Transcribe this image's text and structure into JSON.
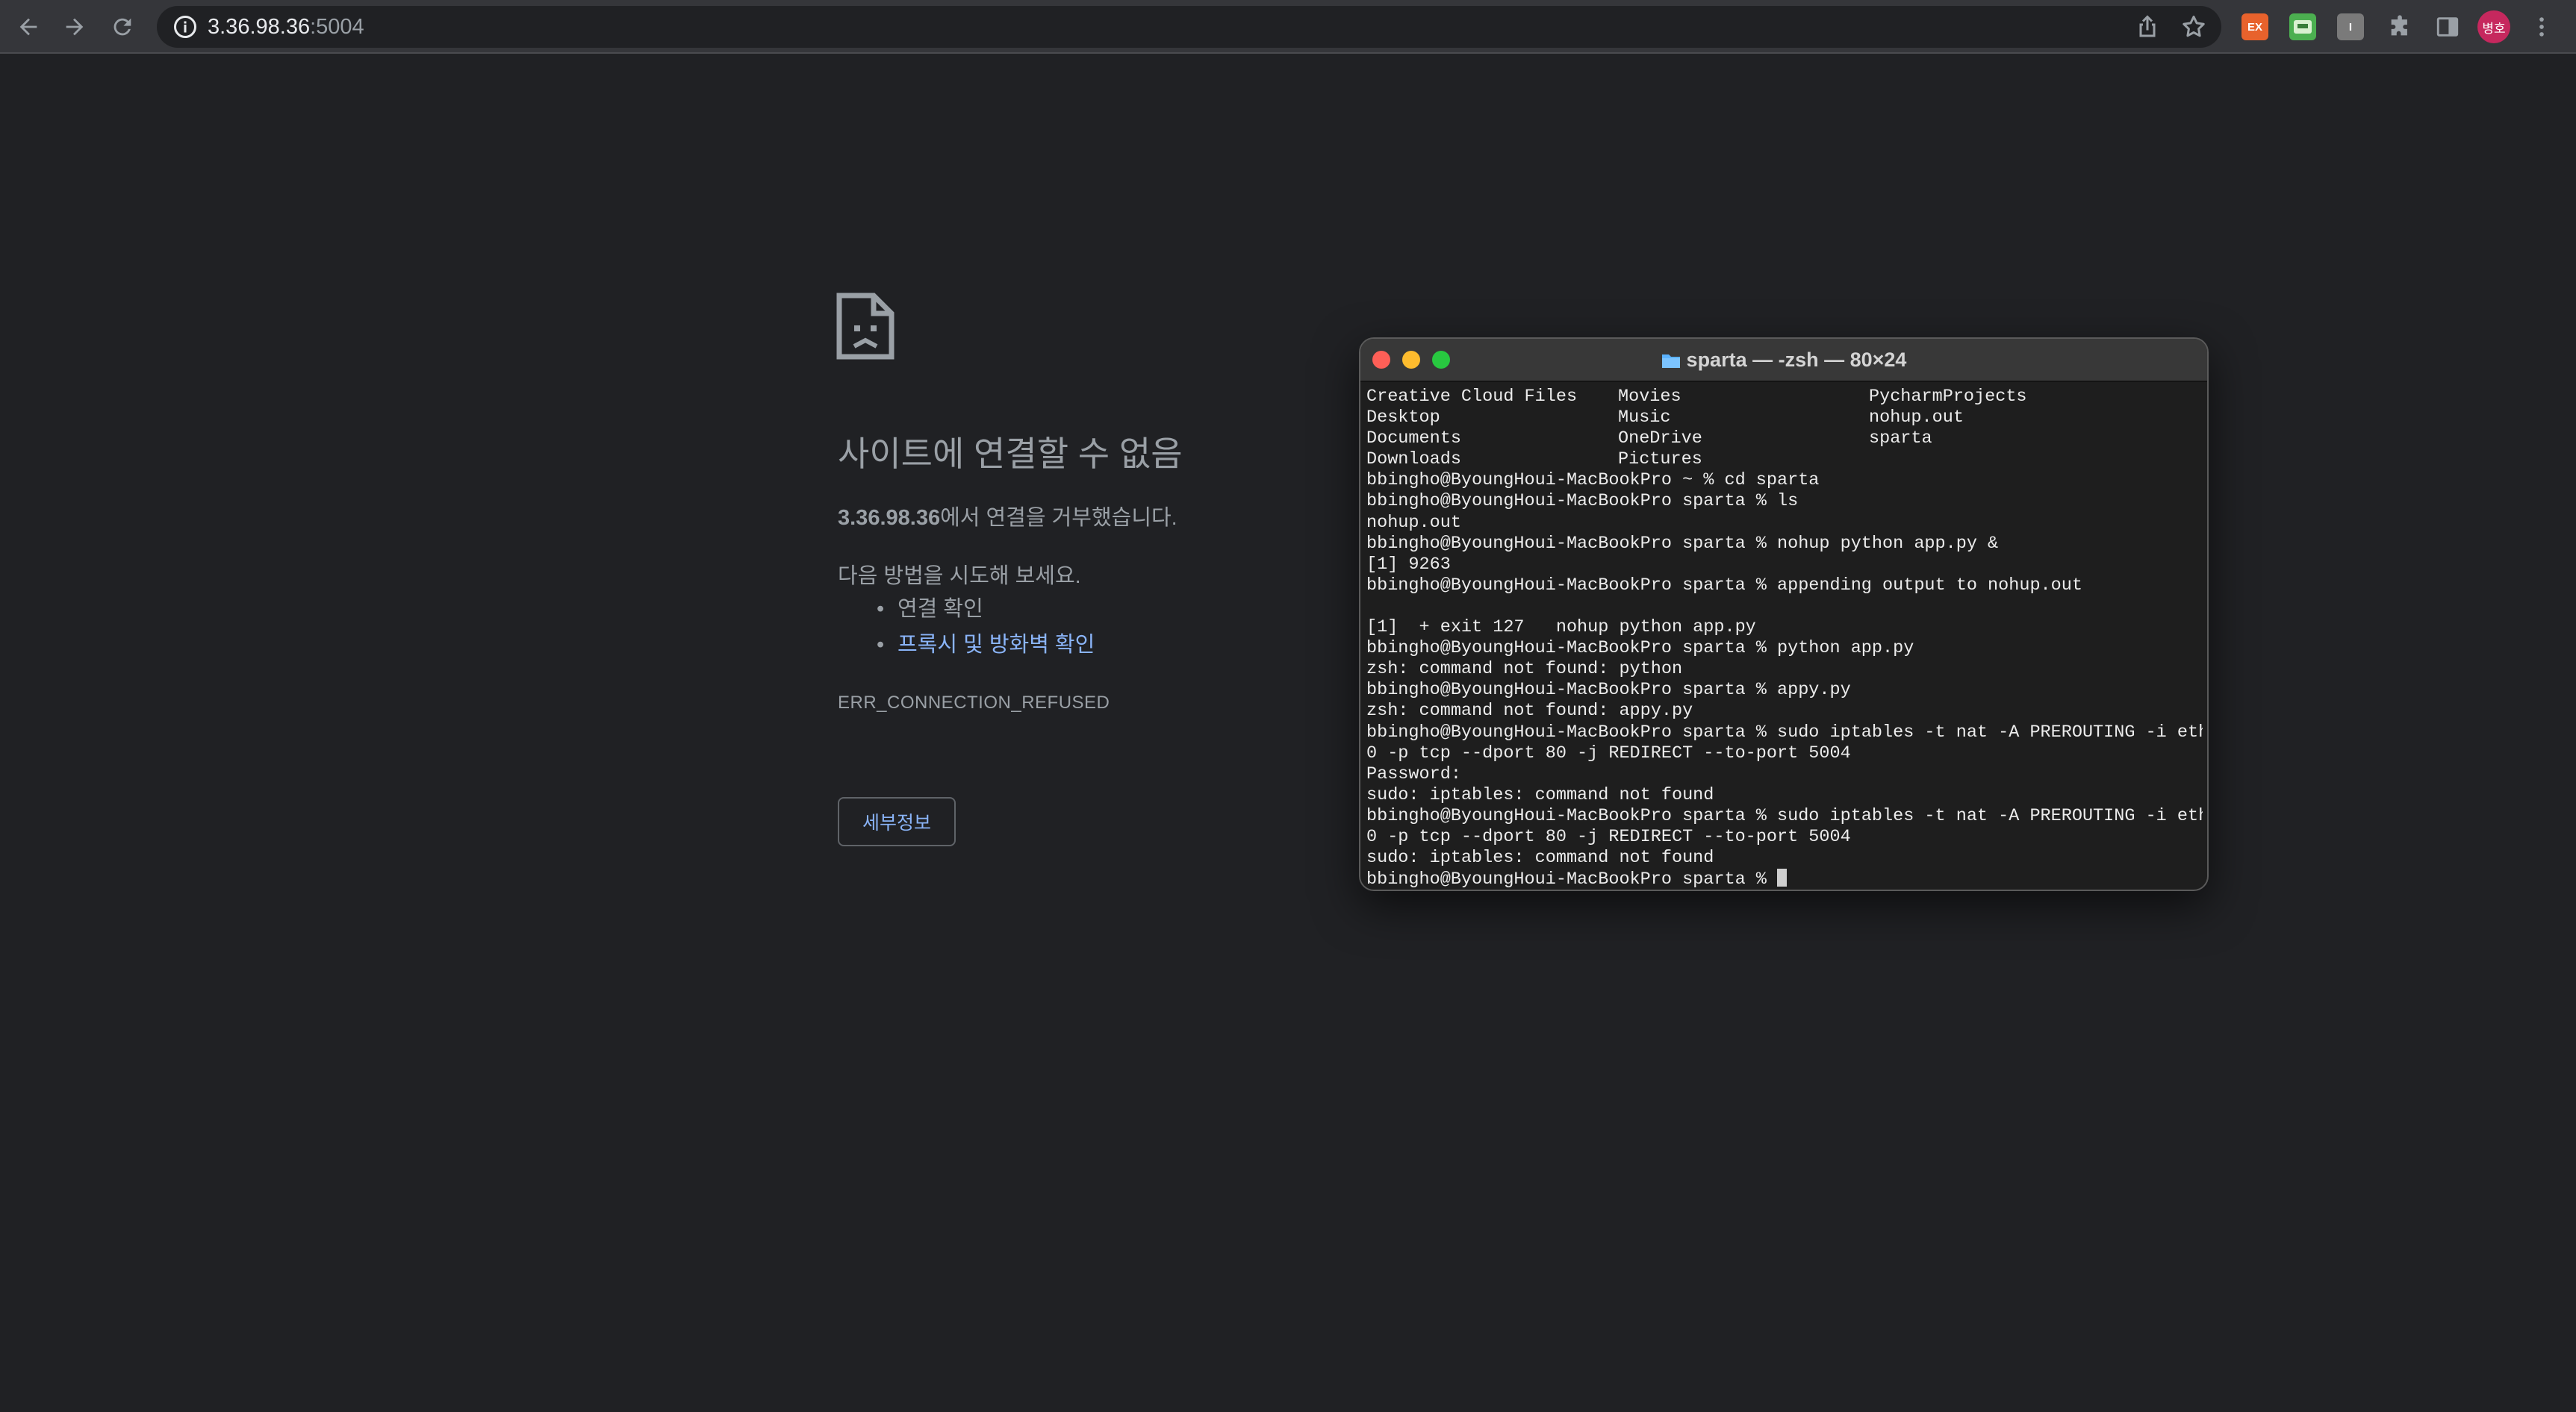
{
  "browser": {
    "url_host": "3.36.98.36",
    "url_port": ":5004",
    "profile_initial": "병호",
    "extensions": [
      {
        "name": "ex-extension-icon",
        "label": "EX",
        "color": "#e8622c"
      },
      {
        "name": "translate-extension-icon",
        "label": "",
        "color": "#4caf50"
      },
      {
        "name": "i-extension-icon",
        "label": "I",
        "color": "#7a7a7a"
      }
    ]
  },
  "error_page": {
    "heading": "사이트에 연결할 수 없음",
    "summary_host": "3.36.98.36",
    "summary_text": "에서 연결을 거부했습니다.",
    "try_heading": "다음 방법을 시도해 보세요.",
    "suggestions": [
      "연결 확인",
      "프록시 및 방화벽 확인"
    ],
    "error_code": "ERR_CONNECTION_REFUSED",
    "details_button": "세부정보"
  },
  "terminal": {
    "title": "sparta — -zsh — 80×24",
    "ls_output": [
      [
        "Creative Cloud Files",
        "Movies",
        "PycharmProjects"
      ],
      [
        "Desktop",
        "Music",
        "nohup.out"
      ],
      [
        "Documents",
        "OneDrive",
        "sparta"
      ],
      [
        "Downloads",
        "Pictures",
        ""
      ]
    ],
    "lines": [
      "bbingho@ByoungHoui-MacBookPro ~ % cd sparta",
      "bbingho@ByoungHoui-MacBookPro sparta % ls",
      "nohup.out",
      "bbingho@ByoungHoui-MacBookPro sparta % nohup python app.py &",
      "[1] 9263",
      "bbingho@ByoungHoui-MacBookPro sparta % appending output to nohup.out",
      "",
      "[1]  + exit 127   nohup python app.py",
      "bbingho@ByoungHoui-MacBookPro sparta % python app.py",
      "zsh: command not found: python",
      "bbingho@ByoungHoui-MacBookPro sparta % appy.py",
      "zsh: command not found: appy.py",
      "bbingho@ByoungHoui-MacBookPro sparta % sudo iptables -t nat -A PREROUTING -i eth",
      "0 -p tcp --dport 80 -j REDIRECT --to-port 5004",
      "Password:",
      "sudo: iptables: command not found",
      "bbingho@ByoungHoui-MacBookPro sparta % sudo iptables -t nat -A PREROUTING -i eth",
      "0 -p tcp --dport 80 -j REDIRECT --to-port 5004",
      "sudo: iptables: command not found"
    ],
    "prompt": "bbingho@ByoungHoui-MacBookPro sparta % "
  }
}
